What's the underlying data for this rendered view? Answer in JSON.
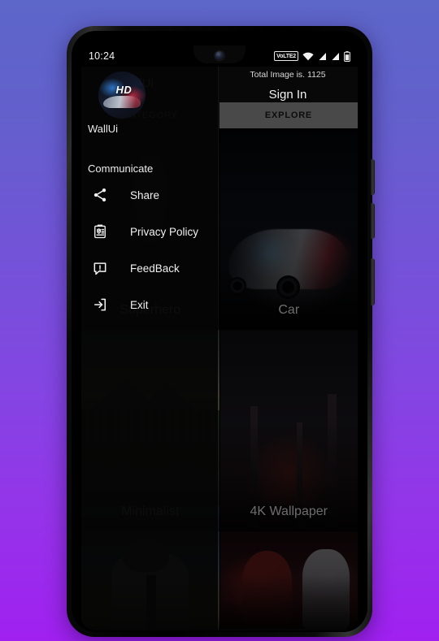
{
  "status_bar": {
    "time": "10:24",
    "volte_badge": "VoLTE2",
    "icons": [
      "wifi-icon",
      "signal-1-icon",
      "signal-2-icon",
      "battery-icon"
    ]
  },
  "app_bar": {
    "title": "WallUi",
    "total_images_label": "Total Image is.  1125",
    "sign_in_label": "Sign In",
    "menu_icon": "hamburger-menu-icon"
  },
  "tabs": [
    {
      "label": "CATEGORY",
      "selected": false
    },
    {
      "label": "EXPLORE",
      "selected": true
    }
  ],
  "drawer": {
    "app_name": "WallUi",
    "avatar_badge": "HD",
    "section_title": "Communicate",
    "items": [
      {
        "label": "Share",
        "icon": "share-icon"
      },
      {
        "label": "Privacy Policy",
        "icon": "privacy-clipboard-icon"
      },
      {
        "label": "FeedBack",
        "icon": "feedback-message-icon"
      },
      {
        "label": "Exit",
        "icon": "exit-logout-icon"
      }
    ]
  },
  "categories": [
    {
      "label": "Superhero"
    },
    {
      "label": "Car"
    },
    {
      "label": "Minimalist"
    },
    {
      "label": "4K Wallpaper"
    }
  ],
  "colors": {
    "background_top": "#5d66c9",
    "background_bottom": "#a020f0",
    "tab_active_bg": "#9a9a9a",
    "drawer_bg": "#050505",
    "text_primary": "#f0f0f0"
  }
}
